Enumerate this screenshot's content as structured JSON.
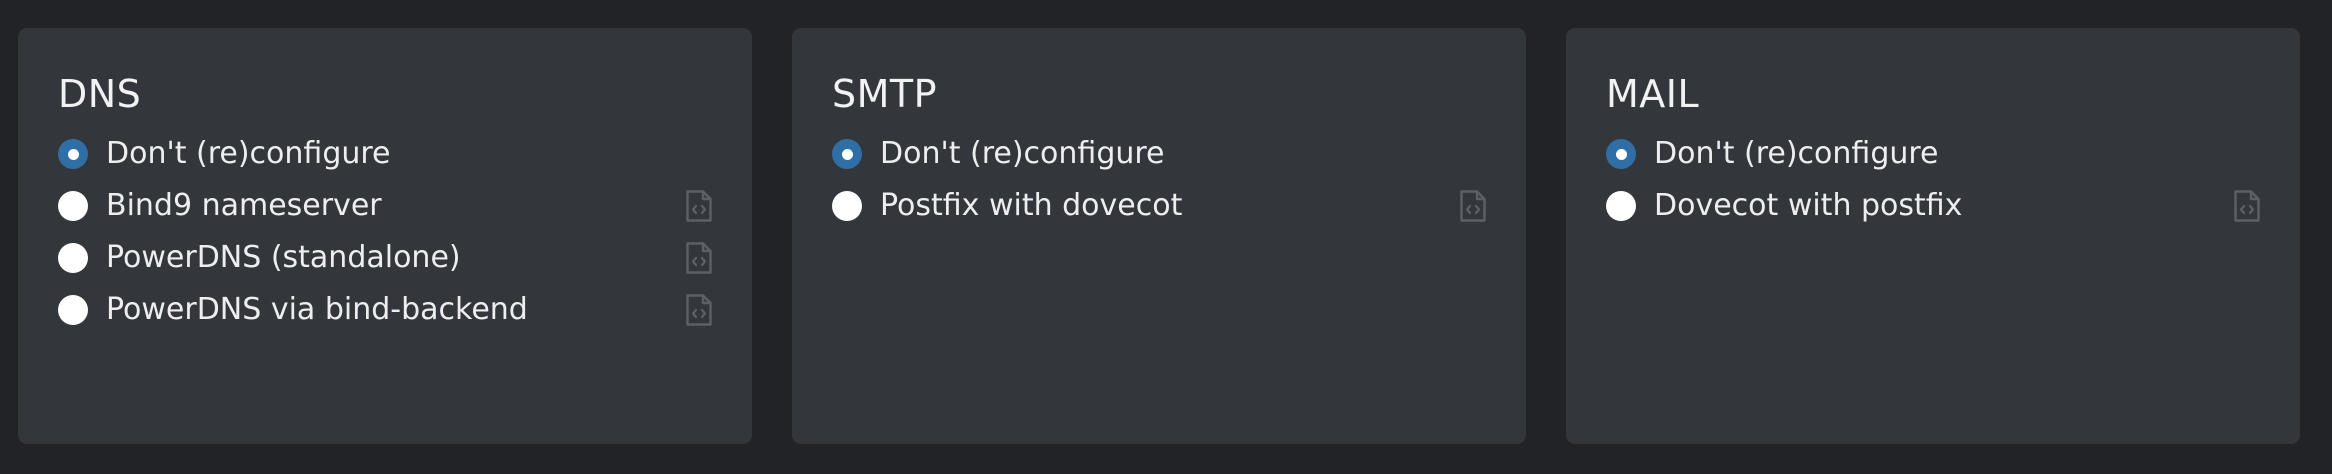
{
  "panels": [
    {
      "title": "DNS",
      "options": [
        {
          "label": "Don't (re)configure",
          "selected": true,
          "has_config": false
        },
        {
          "label": "Bind9 nameserver",
          "selected": false,
          "has_config": true
        },
        {
          "label": "PowerDNS (standalone)",
          "selected": false,
          "has_config": true
        },
        {
          "label": "PowerDNS via bind-backend",
          "selected": false,
          "has_config": true
        }
      ]
    },
    {
      "title": "SMTP",
      "options": [
        {
          "label": "Don't (re)configure",
          "selected": true,
          "has_config": false
        },
        {
          "label": "Postfix with dovecot",
          "selected": false,
          "has_config": true
        }
      ]
    },
    {
      "title": "MAIL",
      "options": [
        {
          "label": "Don't (re)configure",
          "selected": true,
          "has_config": false
        },
        {
          "label": "Dovecot with postfix",
          "selected": false,
          "has_config": true
        }
      ]
    }
  ],
  "icons": {
    "config_file": "file-code-icon"
  },
  "colors": {
    "background": "#212327",
    "card": "#33373b",
    "radio_selected": "#2f6fa6",
    "radio_unselected": "#ffffff",
    "icon": "#5c6167"
  }
}
